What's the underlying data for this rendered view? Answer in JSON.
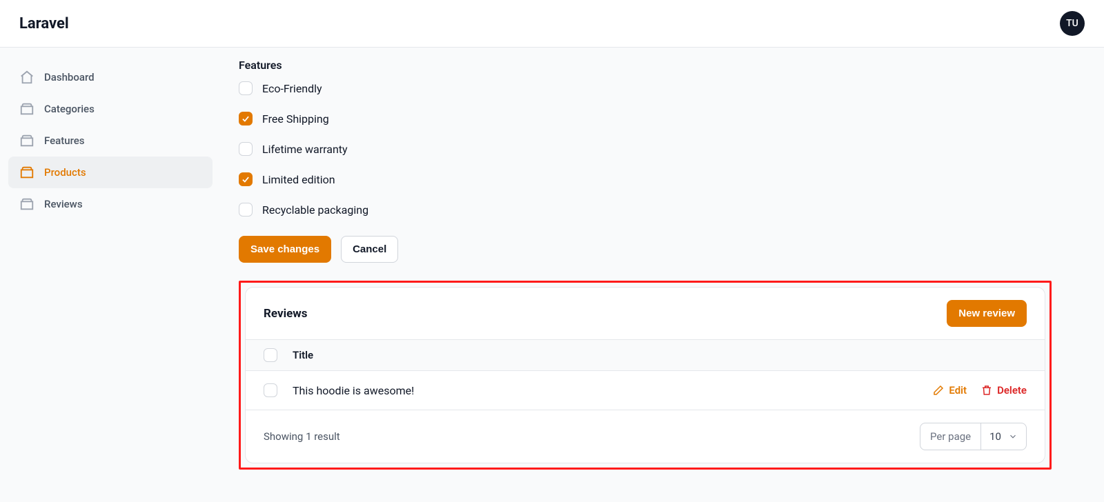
{
  "header": {
    "brand": "Laravel",
    "avatar_initials": "TU"
  },
  "sidebar": {
    "items": [
      {
        "label": "Dashboard"
      },
      {
        "label": "Categories"
      },
      {
        "label": "Features"
      },
      {
        "label": "Products"
      },
      {
        "label": "Reviews"
      }
    ]
  },
  "features": {
    "heading": "Features",
    "items": [
      {
        "label": "Eco-Friendly",
        "checked": false
      },
      {
        "label": "Free Shipping",
        "checked": true
      },
      {
        "label": "Lifetime warranty",
        "checked": false
      },
      {
        "label": "Limited edition",
        "checked": true
      },
      {
        "label": "Recyclable packaging",
        "checked": false
      }
    ]
  },
  "actions": {
    "save": "Save changes",
    "cancel": "Cancel"
  },
  "reviews": {
    "title": "Reviews",
    "new_button": "New review",
    "columns": {
      "title": "Title"
    },
    "rows": [
      {
        "title": "This hoodie is awesome!"
      }
    ],
    "row_actions": {
      "edit": "Edit",
      "delete": "Delete"
    },
    "footer": {
      "showing": "Showing 1 result",
      "per_page_label": "Per page",
      "per_page_value": "10"
    }
  }
}
